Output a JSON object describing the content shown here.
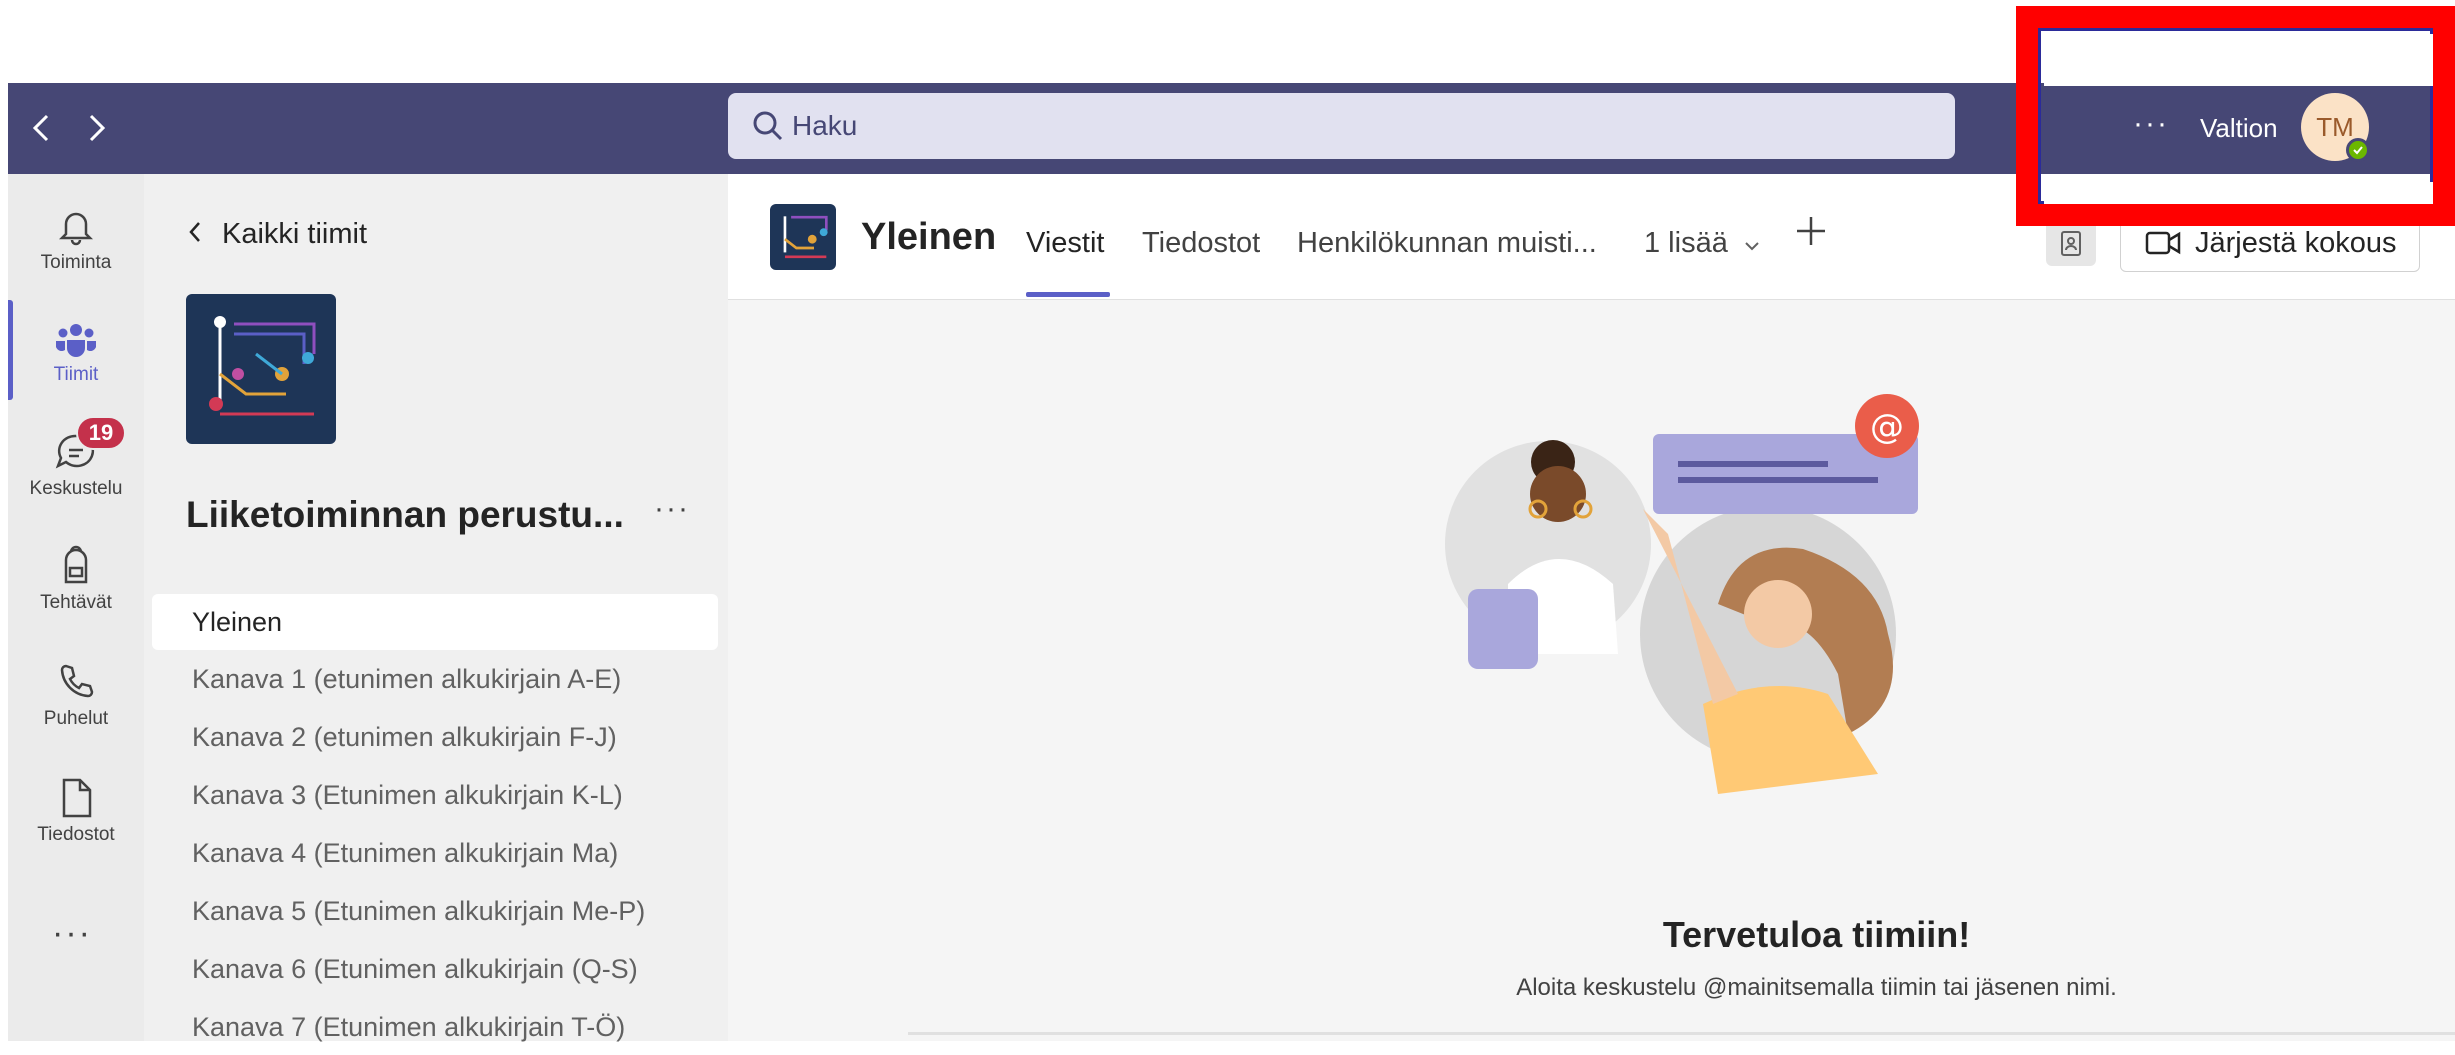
{
  "topbar": {
    "search_placeholder": "Haku",
    "more_label": "···",
    "user_name": "Valtion",
    "avatar_initials": "TM"
  },
  "rail": {
    "items": [
      {
        "label": "Toiminta",
        "icon": "bell-icon"
      },
      {
        "label": "Tiimit",
        "icon": "teams-icon"
      },
      {
        "label": "Keskustelu",
        "icon": "chat-icon",
        "badge": "19"
      },
      {
        "label": "Tehtävät",
        "icon": "backpack-icon"
      },
      {
        "label": "Puhelut",
        "icon": "phone-icon"
      },
      {
        "label": "Tiedostot",
        "icon": "file-icon"
      }
    ],
    "more_label": "···"
  },
  "team_panel": {
    "back_label": "Kaikki tiimit",
    "team_name": "Liiketoiminnan perustu...",
    "more_label": "···",
    "channels": [
      "Yleinen",
      "Kanava 1 (etunimen alkukirjain A-E)",
      "Kanava 2 (etunimen alkukirjain F-J)",
      "Kanava 3 (Etunimen alkukirjain K-L)",
      "Kanava 4 (Etunimen alkukirjain Ma)",
      "Kanava 5 (Etunimen alkukirjain Me-P)",
      "Kanava 6 (Etunimen alkukirjain (Q-S)",
      "Kanava 7 (Etunimen alkukirjain T-Ö)"
    ],
    "selected_channel": 0
  },
  "main": {
    "channel_title": "Yleinen",
    "tabs": [
      "Viestit",
      "Tiedostot",
      "Henkilökunnan muisti...",
      "1 lisää"
    ],
    "meet_label": "Järjestä kokous",
    "welcome_title": "Tervetuloa tiimiin!",
    "welcome_subtitle": "Aloita keskustelu @mainitsemalla tiimin tai jäsenen nimi."
  },
  "colors": {
    "topbar": "#464775",
    "accent": "#5b5fc7",
    "badge": "#c4314b",
    "presence": "#6bb700",
    "highlight": "#ff0000"
  }
}
